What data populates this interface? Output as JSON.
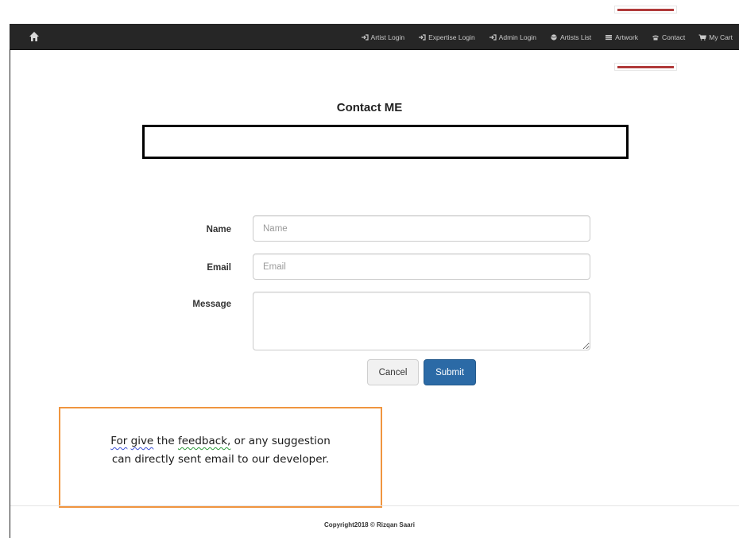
{
  "navbar": {
    "items": [
      {
        "label": "Artist Login",
        "icon": "login-icon"
      },
      {
        "label": "Expertise Login",
        "icon": "login-icon"
      },
      {
        "label": "Admin Login",
        "icon": "login-icon"
      },
      {
        "label": "Artists List",
        "icon": "globe-icon"
      },
      {
        "label": "Artwork",
        "icon": "list-icon"
      },
      {
        "label": "Contact",
        "icon": "phone-icon"
      },
      {
        "label": "My Cart",
        "icon": "cart-icon"
      }
    ]
  },
  "page": {
    "title": "Contact ME"
  },
  "form": {
    "name_label": "Name",
    "name_placeholder": "Name",
    "email_label": "Email",
    "email_placeholder": "Email",
    "message_label": "Message",
    "cancel_label": "Cancel",
    "submit_label": "Submit"
  },
  "note": {
    "word1": "For",
    "word2": "give",
    "word3": "the",
    "word4": "feedback,",
    "rest_line1": "or any suggestion",
    "line2": "can directly sent email to our developer."
  },
  "footer": {
    "copyright": "Copyright2018 © Rizqan Saari"
  },
  "colors": {
    "navbar_bg": "#262626",
    "submit_bg": "#2b6aa6",
    "note_border": "#f0953f",
    "marker_red": "#b03a3a"
  }
}
